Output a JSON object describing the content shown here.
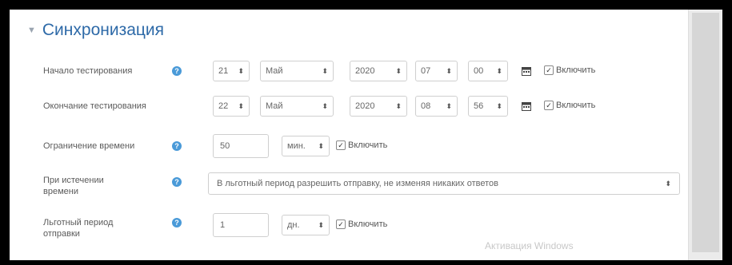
{
  "section": {
    "title": "Синхронизация",
    "collapse_icon": "chevron-down-icon"
  },
  "open": {
    "label": "Начало тестирования",
    "day": "21",
    "month": "Май",
    "year": "2020",
    "hour": "07",
    "minute": "00",
    "enable_label": "Включить",
    "enabled": true
  },
  "close": {
    "label": "Окончание тестирования",
    "day": "22",
    "month": "Май",
    "year": "2020",
    "hour": "08",
    "minute": "56",
    "enable_label": "Включить",
    "enabled": true
  },
  "timelimit": {
    "label": "Ограничение времени",
    "value": "50",
    "unit": "мин.",
    "enable_label": "Включить",
    "enabled": true
  },
  "overdue": {
    "label_line1": "При истечении",
    "label_line2": "времени",
    "value": "В льготный период разрешить отправку, не изменяя никаких ответов"
  },
  "grace": {
    "label_line1": "Льготный период",
    "label_line2": "отправки",
    "value": "1",
    "unit": "дн.",
    "enable_label": "Включить",
    "enabled": true
  },
  "watermark": {
    "text": "Активация Windows"
  },
  "colors": {
    "accent": "#2e6aa8",
    "help": "#4a9ad8",
    "border": "#cfcfcf"
  }
}
